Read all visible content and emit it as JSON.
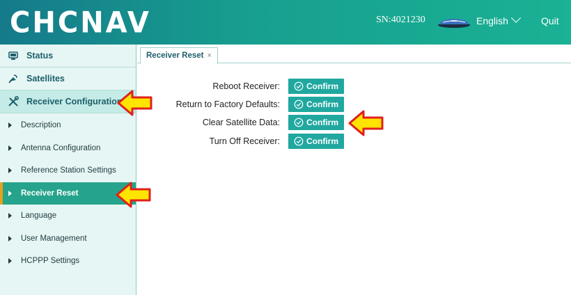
{
  "header": {
    "logo_text": "CHCNAV",
    "serial": "SN:4021230",
    "language": "English",
    "quit_label": "Quit",
    "device_icon": "receiver-device-icon"
  },
  "sidebar": {
    "top_items": [
      {
        "label": "Status",
        "icon": "status-icon"
      },
      {
        "label": "Satellites",
        "icon": "satellite-icon"
      },
      {
        "label": "Receiver Configuration",
        "icon": "tools-icon"
      }
    ],
    "sub_items": [
      {
        "label": "Description"
      },
      {
        "label": "Antenna Configuration"
      },
      {
        "label": "Reference Station Settings"
      },
      {
        "label": "Receiver Reset",
        "selected": true
      },
      {
        "label": "Language"
      },
      {
        "label": "User Management"
      },
      {
        "label": "HCPPP Settings"
      }
    ]
  },
  "tab": {
    "label": "Receiver Reset",
    "close_symbol": "×"
  },
  "reset": {
    "rows": [
      {
        "label": "Reboot Receiver:",
        "button": "Confirm"
      },
      {
        "label": "Return to Factory Defaults:",
        "button": "Confirm"
      },
      {
        "label": "Clear Satellite Data:",
        "button": "Confirm"
      },
      {
        "label": "Turn Off Receiver:",
        "button": "Confirm"
      }
    ]
  },
  "colors": {
    "header_start": "#157a8a",
    "header_end": "#1ab195",
    "button": "#20a8a0",
    "selected_item": "#25a38c",
    "arrow_fill": "#ffe400",
    "arrow_stroke": "#e0201c"
  }
}
